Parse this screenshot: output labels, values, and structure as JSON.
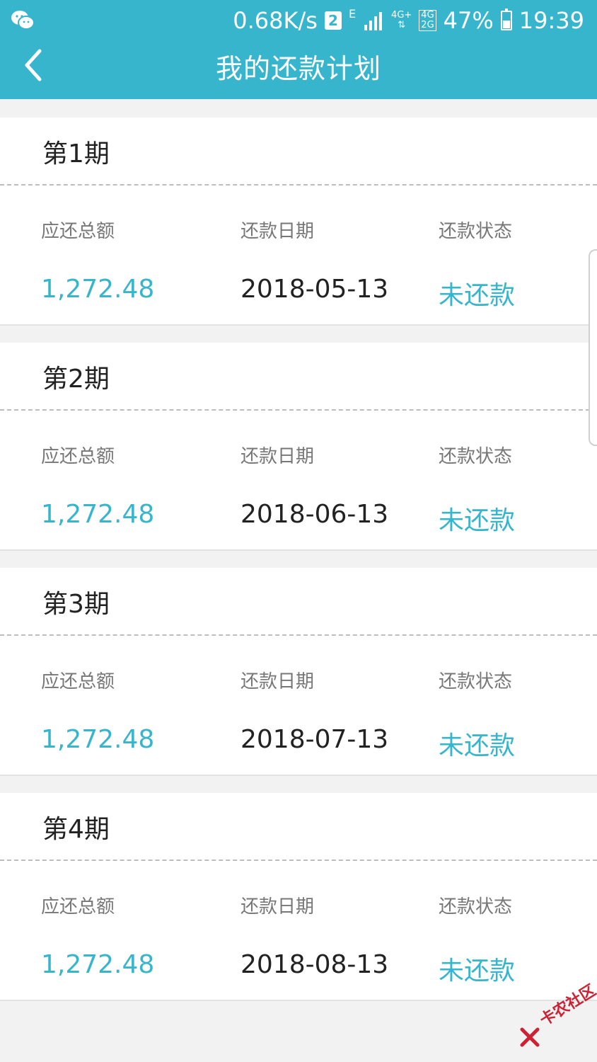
{
  "status_bar": {
    "speed": "0.68K/s",
    "sim_slot": "2",
    "net_small": "E",
    "net_4g_plus": "4G+",
    "net_4g": "4G",
    "net_2g": "2G",
    "battery": "47%",
    "time": "19:39"
  },
  "nav": {
    "title": "我的还款计划"
  },
  "labels": {
    "amount": "应还总额",
    "date": "还款日期",
    "status": "还款状态"
  },
  "plans": [
    {
      "period": "第1期",
      "amount": "1,272.48",
      "date": "2018-05-13",
      "status": "未还款"
    },
    {
      "period": "第2期",
      "amount": "1,272.48",
      "date": "2018-06-13",
      "status": "未还款"
    },
    {
      "period": "第3期",
      "amount": "1,272.48",
      "date": "2018-07-13",
      "status": "未还款"
    },
    {
      "period": "第4期",
      "amount": "1,272.48",
      "date": "2018-08-13",
      "status": "未还款"
    }
  ],
  "watermark": "卡农社区",
  "colors": {
    "accent": "#36b5cc",
    "watermark": "#cc2233"
  }
}
